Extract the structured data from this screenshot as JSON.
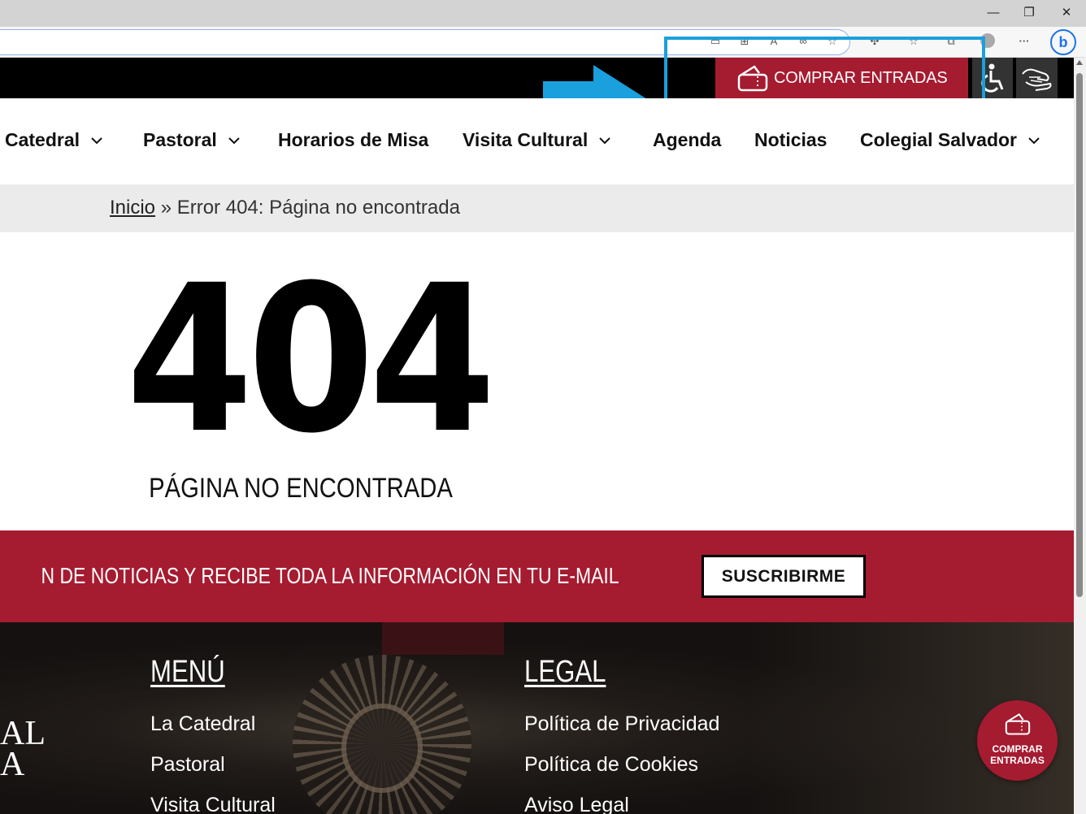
{
  "browser": {
    "window_controls": {
      "minimize": "—",
      "restore": "❐",
      "close": "✕"
    },
    "toolbar_icons": [
      "reader-icon",
      "apps-icon",
      "read-aloud-icon",
      "immersive-icon",
      "add-favorite-icon",
      "extensions-icon",
      "favorites-icon",
      "collections-icon",
      "profile-icon",
      "more-icon"
    ],
    "more_label": "···",
    "bing_label": "b"
  },
  "header": {
    "buy_tickets_label": "COMPRAR ENTRADAS",
    "accessibility_icon": "wheelchair-icon",
    "sign_language_icon": "sign-language-icon"
  },
  "nav": {
    "items": [
      {
        "label": "Catedral",
        "dropdown": true
      },
      {
        "label": "Pastoral",
        "dropdown": true
      },
      {
        "label": "Horarios de Misa",
        "dropdown": false
      },
      {
        "label": "Visita Cultural",
        "dropdown": true
      },
      {
        "label": "Agenda",
        "dropdown": false
      },
      {
        "label": "Noticias",
        "dropdown": false
      },
      {
        "label": "Colegial Salvador",
        "dropdown": true
      }
    ]
  },
  "breadcrumb": {
    "home": "Inicio",
    "separator": " » ",
    "current": "Error 404: Página no encontrada"
  },
  "error": {
    "code": "404",
    "message": "PÁGINA NO ENCONTRADA"
  },
  "newsletter": {
    "text": "N DE NOTICIAS Y RECIBE TODA LA INFORMACIÓN EN TU E-MAIL",
    "button": "SUSCRIBIRME"
  },
  "footer": {
    "logo_lines": [
      "AL",
      "A"
    ],
    "menu": {
      "title": "MENÚ",
      "links": [
        "La Catedral",
        "Pastoral",
        "Visita Cultural"
      ]
    },
    "legal": {
      "title": "LEGAL",
      "links": [
        "Política de Privacidad",
        "Política de Cookies",
        "Aviso Legal"
      ]
    }
  },
  "fab": {
    "line1": "COMPRAR",
    "line2": "ENTRADAS"
  },
  "colors": {
    "brand_red": "#a51b30",
    "highlight_blue": "#1aa0dd",
    "top_bar": "#000000"
  }
}
